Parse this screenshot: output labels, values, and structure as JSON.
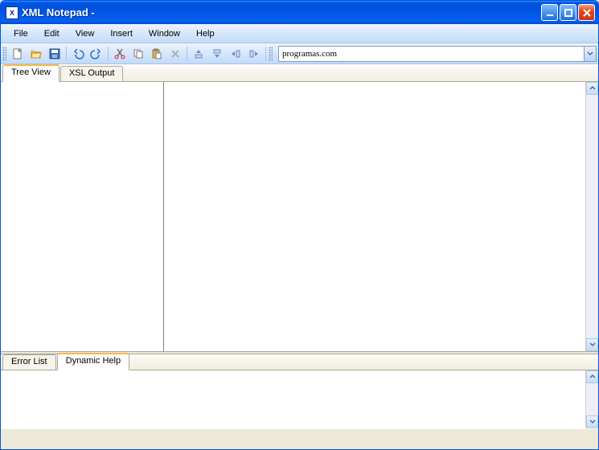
{
  "window": {
    "title": "XML Notepad -"
  },
  "menu": {
    "file": "File",
    "edit": "Edit",
    "view": "View",
    "insert": "Insert",
    "window": "Window",
    "help": "Help"
  },
  "toolbar": {
    "location_value": "programas.com"
  },
  "tabs_top": {
    "tree_view": "Tree View",
    "xsl_output": "XSL Output"
  },
  "tabs_bottom": {
    "error_list": "Error List",
    "dynamic_help": "Dynamic Help"
  },
  "icons": {
    "new": "new-file-icon",
    "open": "open-folder-icon",
    "save": "save-icon",
    "undo": "undo-icon",
    "redo": "redo-icon",
    "cut": "cut-icon",
    "copy": "copy-icon",
    "paste": "paste-icon",
    "delete": "delete-icon",
    "nudge_up": "nudge-up-icon",
    "nudge_down": "nudge-down-icon",
    "nudge_left": "nudge-left-icon",
    "nudge_right": "nudge-right-icon"
  }
}
